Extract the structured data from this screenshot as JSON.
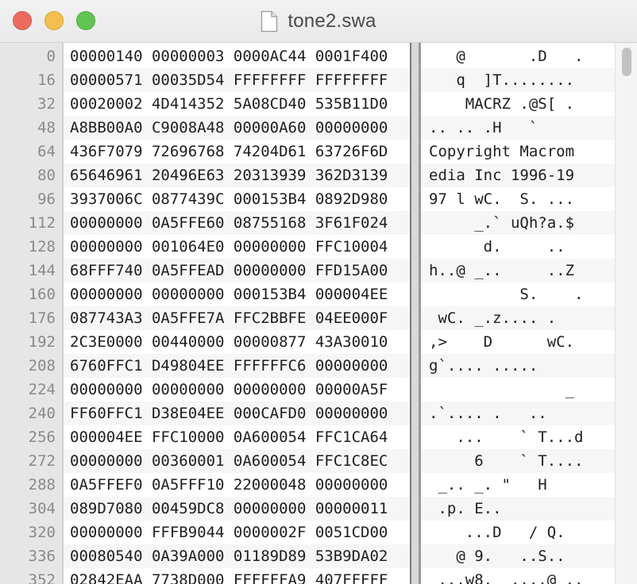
{
  "window": {
    "title": "tone2.swa"
  },
  "rows": [
    {
      "offset": "0",
      "hex": "00000140 00000003 0000AC44 0001F400",
      "ascii": "   @       .D   ."
    },
    {
      "offset": "16",
      "hex": "00000571 00035D54 FFFFFFFF FFFFFFFF",
      "ascii": "   q  ]T........"
    },
    {
      "offset": "32",
      "hex": "00020002 4D414352 5A08CD40 535B11D0",
      "ascii": "    MACRZ .@S[ ."
    },
    {
      "offset": "48",
      "hex": "A8BB00A0 C9008A48 00000A60 00000000",
      "ascii": ".. .. .H   `"
    },
    {
      "offset": "64",
      "hex": "436F7079 72696768 74204D61 63726F6D",
      "ascii": "Copyright Macrom"
    },
    {
      "offset": "80",
      "hex": "65646961 20496E63 20313939 362D3139",
      "ascii": "edia Inc 1996-19"
    },
    {
      "offset": "96",
      "hex": "3937006C 0877439C 000153B4 0892D980",
      "ascii": "97 l wC.  S. ..."
    },
    {
      "offset": "112",
      "hex": "00000000 0A5FFE60 08755168 3F61F024",
      "ascii": "     _.` uQh?a.$"
    },
    {
      "offset": "128",
      "hex": "00000000 001064E0 00000000 FFC10004",
      "ascii": "      d.     .."
    },
    {
      "offset": "144",
      "hex": "68FFF740 0A5FFEAD 00000000 FFD15A00",
      "ascii": "h..@ _..     ..Z"
    },
    {
      "offset": "160",
      "hex": "00000000 00000000 000153B4 000004EE",
      "ascii": "          S.    ."
    },
    {
      "offset": "176",
      "hex": "087743A3 0A5FFE7A FFC2BBFE 04EE000F",
      "ascii": " wC. _.z.... ."
    },
    {
      "offset": "192",
      "hex": "2C3E0000 00440000 00000877 43A30010",
      "ascii": ",>    D      wC."
    },
    {
      "offset": "208",
      "hex": "6760FFC1 D49804EE FFFFFFC6 00000000",
      "ascii": "g`.... ....."
    },
    {
      "offset": "224",
      "hex": "00000000 00000000 00000000 00000A5F",
      "ascii": "               _"
    },
    {
      "offset": "240",
      "hex": "FF60FFC1 D38E04EE 000CAFD0 00000000",
      "ascii": ".`.... .   .."
    },
    {
      "offset": "256",
      "hex": "000004EE FFC10000 0A600054 FFC1CA64",
      "ascii": "   ...    ` T...d"
    },
    {
      "offset": "272",
      "hex": "00000000 00360001 0A600054 FFC1C8EC",
      "ascii": "     6    ` T...."
    },
    {
      "offset": "288",
      "hex": "0A5FFEF0 0A5FFF10 22000048 00000000",
      "ascii": " _.. _. \"   H"
    },
    {
      "offset": "304",
      "hex": "089D7080 00459DC8 00000000 00000011",
      "ascii": " .p. E.."
    },
    {
      "offset": "320",
      "hex": "00000000 FFFB9044 0000002F 0051CD00",
      "ascii": "    ...D   / Q."
    },
    {
      "offset": "336",
      "hex": "00080540 0A39A000 01189D89 53B9DA02",
      "ascii": "   @ 9.   ..S.."
    },
    {
      "offset": "352",
      "hex": "02842EAA 7738D000 FFFFFFA9 407FFFFF",
      "ascii": " ...w8.  ....@ .."
    }
  ],
  "icons": {
    "document": "document-icon"
  },
  "colors": {
    "close": "#ed6a5e",
    "minimize": "#f5bf4f",
    "maximize": "#61c554",
    "gutter": "#e6e6e6",
    "offset_text": "#8a8a8a",
    "text": "#1e1e1e"
  }
}
